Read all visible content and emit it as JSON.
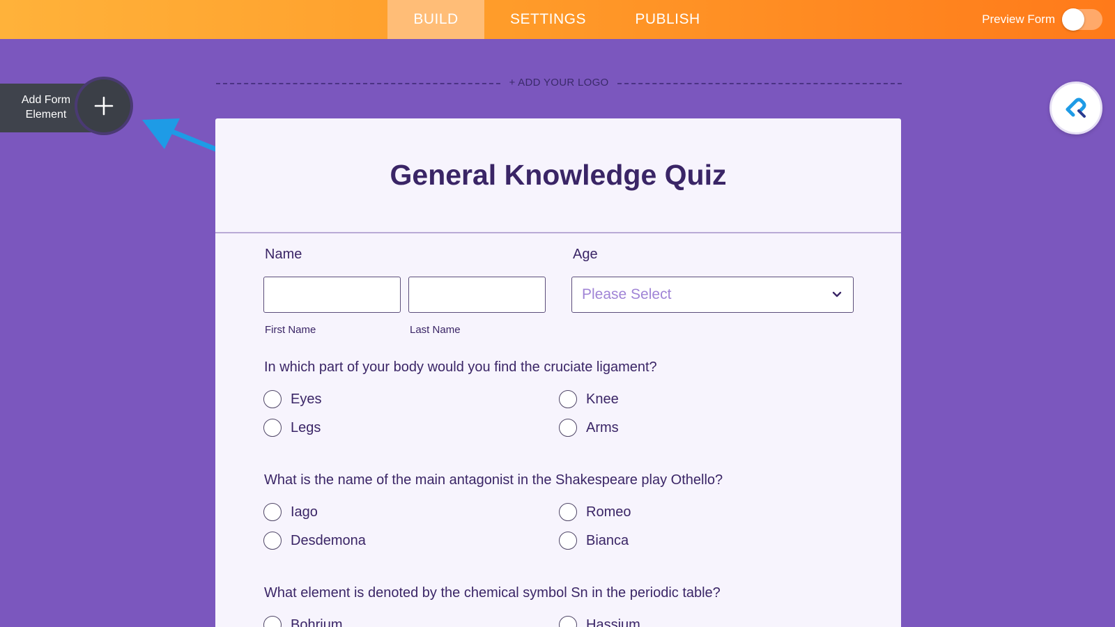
{
  "topbar": {
    "tabs": [
      {
        "label": "BUILD"
      },
      {
        "label": "SETTINGS"
      },
      {
        "label": "PUBLISH"
      }
    ],
    "preview_label": "Preview Form",
    "preview_on": false
  },
  "sidebar": {
    "add_element_label": "Add Form Element"
  },
  "logo": {
    "label": "+ ADD YOUR LOGO"
  },
  "form": {
    "title": "General Knowledge Quiz",
    "name_label": "Name",
    "first_name_sublabel": "First Name",
    "last_name_sublabel": "Last Name",
    "age_label": "Age",
    "age_placeholder": "Please Select",
    "questions": [
      {
        "text": "In which part of your body would you find the cruciate ligament?",
        "options": [
          "Eyes",
          "Knee",
          "Legs",
          "Arms"
        ]
      },
      {
        "text": "What is the name of the main antagonist in the Shakespeare play Othello?",
        "options": [
          "Iago",
          "Romeo",
          "Desdemona",
          "Bianca"
        ]
      },
      {
        "text": "What element is denoted by the chemical symbol Sn in the periodic table?",
        "options": [
          "Bohrium",
          "Hassium"
        ]
      }
    ]
  },
  "colors": {
    "page_background": "#7b57be",
    "topbar_start": "#ffb23a",
    "topbar_end": "#ff7a1a",
    "title_color": "#3a2566",
    "placeholder_color": "#a084d6",
    "arrow_color": "#1e9be6"
  }
}
